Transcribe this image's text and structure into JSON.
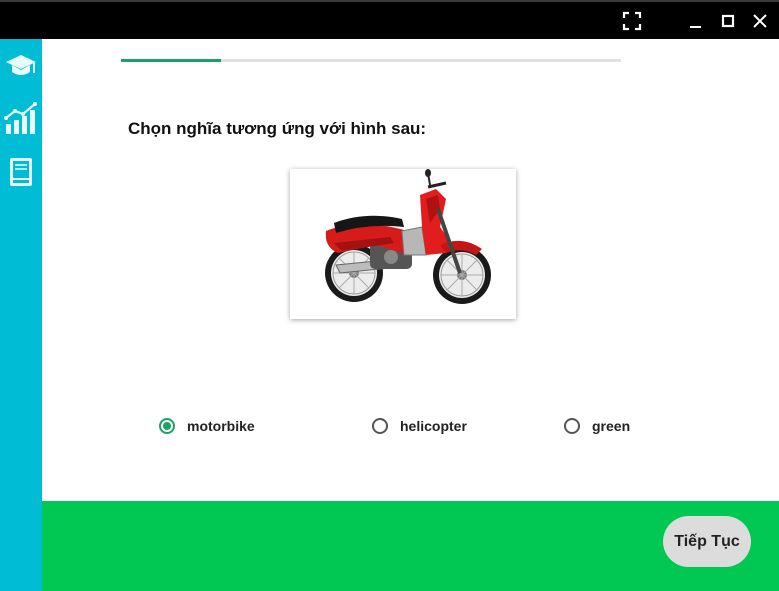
{
  "window": {
    "controls": [
      "fullscreen-icon",
      "minimize-icon",
      "maximize-icon",
      "close-icon"
    ]
  },
  "sidebar": {
    "items": [
      {
        "icon": "graduation-cap-icon",
        "active": true
      },
      {
        "icon": "stats-chart-icon",
        "active": false
      },
      {
        "icon": "book-icon",
        "active": false
      }
    ]
  },
  "progress": {
    "fraction": 0.2
  },
  "question": {
    "text": "Chọn nghĩa tương ứng với hình sau:",
    "image_icon": "motorbike-image"
  },
  "options": [
    {
      "label": "motorbike",
      "selected": true
    },
    {
      "label": "helicopter",
      "selected": false
    },
    {
      "label": "green",
      "selected": false
    }
  ],
  "footer": {
    "next_label": "Tiếp Tục"
  },
  "colors": {
    "sidebar": "#00bcd4",
    "footer": "#00c853",
    "accent": "#19a463",
    "titlebar": "#000000",
    "next_button": "#dcdcdc"
  }
}
